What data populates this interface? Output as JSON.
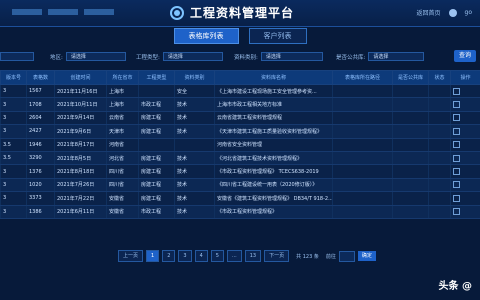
{
  "header": {
    "title": "工程资料管理平台",
    "nav_left": [
      "",
      "",
      ""
    ],
    "user_link": "返回首页",
    "user_name": "go"
  },
  "tabs": [
    "表格库列表",
    "客户列表"
  ],
  "filters": {
    "region_label": "地区:",
    "region_value": "请选择",
    "type_label": "工程类型:",
    "type_value": "请选择",
    "category_label": "资料类别:",
    "category_value": "请选择",
    "public_label": "是否公共库:",
    "public_value": "请选择",
    "query_label": "查询"
  },
  "table": {
    "headers": [
      "版本号",
      "表格数",
      "创建时间",
      "所在省市",
      "工程类型",
      "资料类别",
      "资料库名称",
      "表格库所在路径",
      "是否公共库",
      "状态",
      "操作"
    ],
    "rows": [
      [
        "3",
        "1567",
        "2021年11月16日",
        "上海市",
        "",
        "安全",
        "《上海市建设工程现场施工安全管理参考资...",
        "",
        "",
        "",
        ""
      ],
      [
        "3",
        "1708",
        "2021年10月11日",
        "上海市",
        "市政工程",
        "技术",
        "上海市市政工程相关地方标准",
        "",
        "",
        "",
        ""
      ],
      [
        "3",
        "2604",
        "2021年9月14日",
        "云南省",
        "房建工程",
        "技术",
        "云南省建筑工程资料管理规程",
        "",
        "",
        "",
        ""
      ],
      [
        "3",
        "2427",
        "2021年9月6日",
        "天津市",
        "房建工程",
        "技术",
        "《天津市建筑工程施工质量验收资料管理规程》",
        "",
        "",
        "",
        ""
      ],
      [
        "3.5",
        "1946",
        "2021年8月17日",
        "河南省",
        "",
        "",
        "河南省安全资料管理",
        "",
        "",
        "",
        ""
      ],
      [
        "3.5",
        "3290",
        "2021年8月5日",
        "河北省",
        "房建工程",
        "技术",
        "《河北省建筑工程技术资料管理规程》",
        "",
        "",
        "",
        ""
      ],
      [
        "3",
        "1376",
        "2021年8月18日",
        "四川省",
        "房建工程",
        "技术",
        "《市政工程资料管理规程》 TCECS638-2019",
        "",
        "",
        "",
        ""
      ],
      [
        "3",
        "1020",
        "2021年7月26日",
        "四川省",
        "房建工程",
        "技术",
        "《四川省工程建设统一用表（2020修订版）》",
        "",
        "",
        "",
        ""
      ],
      [
        "3",
        "3373",
        "2021年7月22日",
        "安徽省",
        "房建工程",
        "技术",
        "安徽省《建筑工程资料管理规程》 DB34/T 918-2...",
        "",
        "",
        "",
        ""
      ],
      [
        "3",
        "1386",
        "2021年6月11日",
        "安徽省",
        "市政工程",
        "技术",
        "《市政工程资料管理规程》",
        "",
        "",
        "",
        ""
      ]
    ]
  },
  "pager": {
    "prev": "上一页",
    "pages": [
      "1",
      "2",
      "3",
      "4",
      "5",
      "...",
      "13"
    ],
    "next": "下一页",
    "info": "共 123 条",
    "go_label": "前往",
    "go": "确定"
  },
  "watermark": "头条 @"
}
